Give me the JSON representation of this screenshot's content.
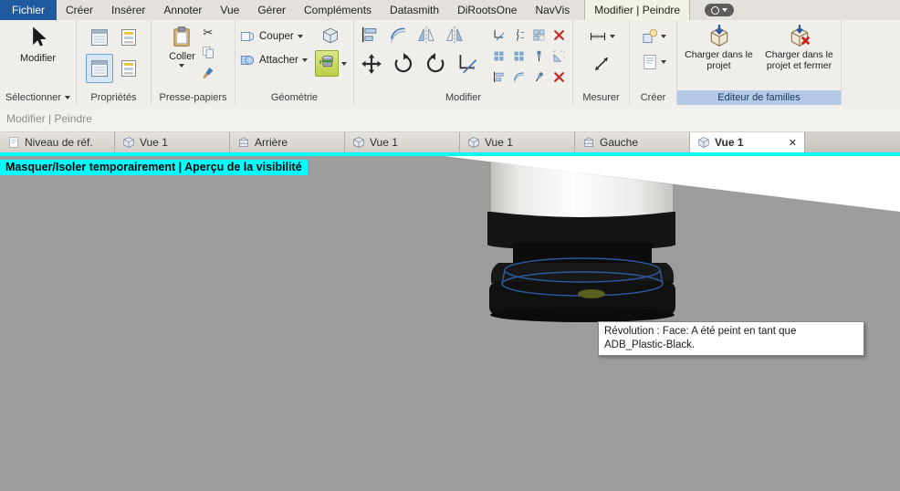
{
  "tab_bar": {
    "tabs": [
      "Fichier",
      "Créer",
      "Insérer",
      "Annoter",
      "Vue",
      "Gérer",
      "Compléments",
      "Datasmith",
      "DiRootsOne",
      "NavVis",
      "Modifier | Peindre"
    ],
    "active_tab": "Modifier | Peindre"
  },
  "ribbon": {
    "select": {
      "label": "Sélectionner",
      "modify": "Modifier"
    },
    "properties": {
      "label": "Propriétés"
    },
    "clipboard": {
      "label": "Presse-papiers",
      "paste": "Coller"
    },
    "geometry": {
      "label": "Géométrie",
      "cut": "Couper",
      "attach": "Attacher"
    },
    "modify": {
      "label": "Modifier"
    },
    "measure": {
      "label": "Mesurer"
    },
    "create": {
      "label": "Créer"
    },
    "family_editor": {
      "label": "Editeur de familles",
      "load": "Charger dans le projet",
      "load_close": "Charger dans le projet et fermer"
    }
  },
  "options_bar": {
    "mode": "Modifier | Peindre"
  },
  "view_tabs": {
    "tabs": [
      "Niveau de réf.",
      "Vue 1",
      "Arrière",
      "Vue 1",
      "Vue 1",
      "Gauche",
      "Vue 1"
    ],
    "active_index": 6,
    "close_glyph": "✕"
  },
  "viewport": {
    "overlay_label": "Masquer/Isoler temporairement | Aperçu de la visibilité",
    "tooltip": "Révolution : Face: A été peint en tant que ADB_Plastic-Black."
  },
  "glyphs": {
    "scissors": "✂"
  },
  "colors": {
    "temporary_hide_cyan": "#00ffff",
    "selection_blue": "#2e5da8",
    "paint_tool_active_green": "#b8cc3e",
    "file_tab_blue": "#1f5a9e",
    "viewport_gray": "#9d9d9d",
    "painted_material_black": "#141414"
  }
}
